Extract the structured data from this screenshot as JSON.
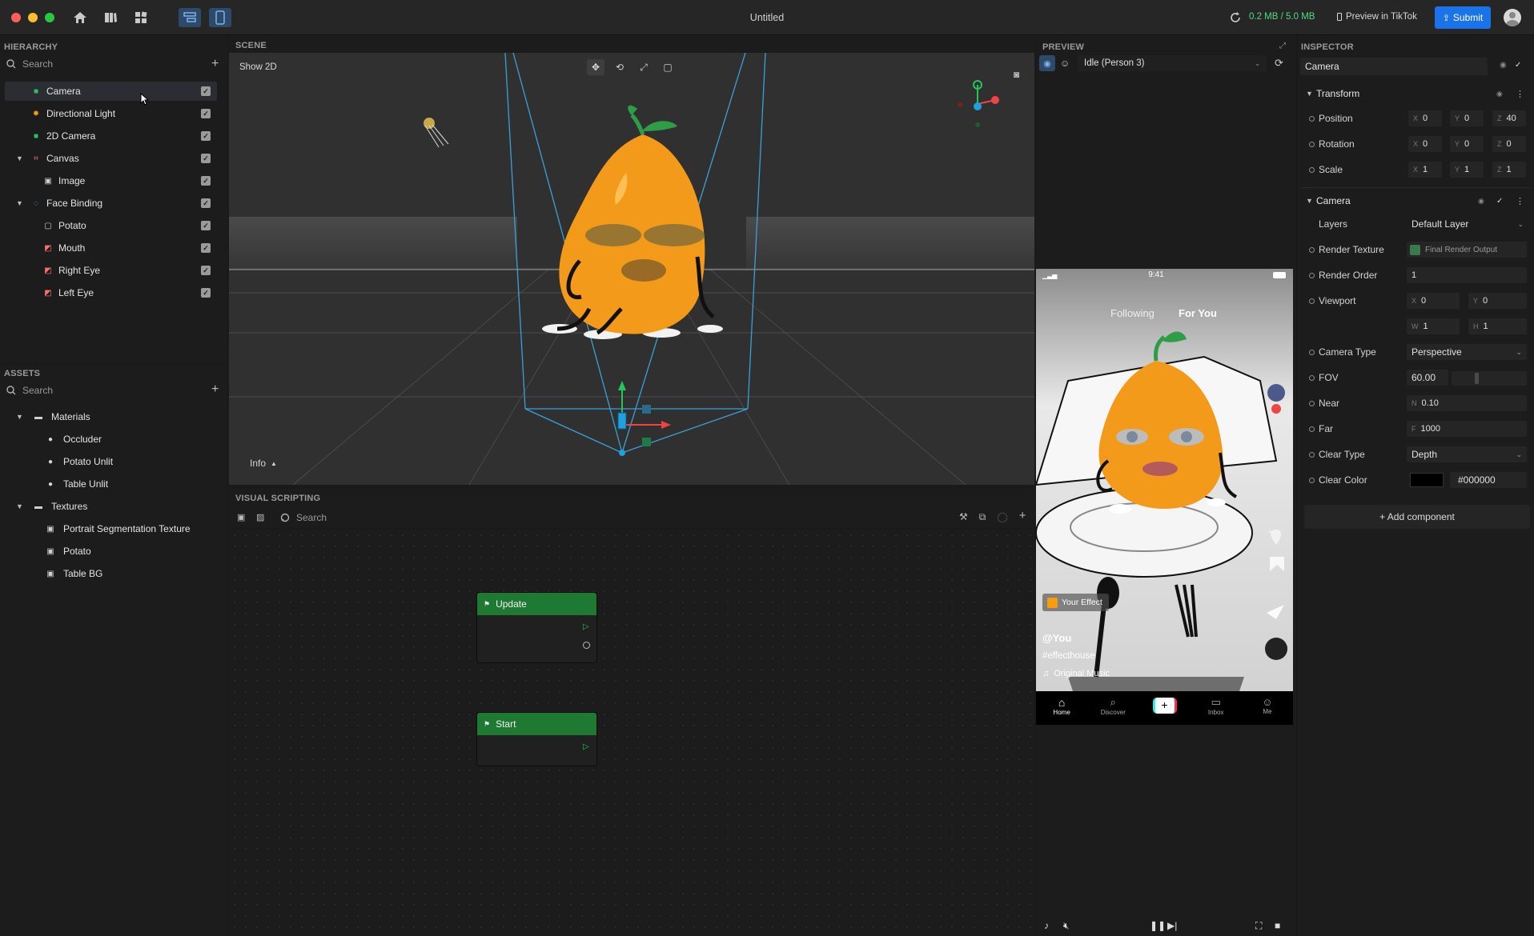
{
  "window": {
    "title": "Untitled",
    "memory": "0.2 MB / 5.0 MB",
    "preview_tiktok": "Preview in TikTok",
    "submit": "Submit"
  },
  "hierarchy": {
    "title": "HIERARCHY",
    "search_placeholder": "Search",
    "items": [
      {
        "label": "Camera",
        "icon": "camera-icon",
        "color": "#22c55e"
      },
      {
        "label": "Directional Light",
        "icon": "sun-icon",
        "color": "#f59e0b"
      },
      {
        "label": "2D Camera",
        "icon": "camera-icon",
        "color": "#22c55e"
      },
      {
        "label": "Canvas",
        "icon": "canvas-icon",
        "color": "#f87171"
      },
      {
        "label": "Image",
        "icon": "image-icon",
        "color": "#cfcfcf"
      },
      {
        "label": "Face Binding",
        "icon": "face-binding-icon",
        "color": "#60a5fa"
      },
      {
        "label": "Potato",
        "icon": "object-icon",
        "color": "#cfcfcf"
      },
      {
        "label": "Mouth",
        "icon": "face-sticker-icon",
        "color": "#f87171"
      },
      {
        "label": "Right Eye",
        "icon": "face-sticker-icon",
        "color": "#f87171"
      },
      {
        "label": "Left Eye",
        "icon": "face-sticker-icon",
        "color": "#f87171"
      }
    ]
  },
  "assets": {
    "title": "ASSETS",
    "search_placeholder": "Search",
    "items": [
      {
        "label": "Materials",
        "icon": "folder-icon"
      },
      {
        "label": "Occluder",
        "icon": "material-icon"
      },
      {
        "label": "Potato Unlit",
        "icon": "material-icon"
      },
      {
        "label": "Table Unlit",
        "icon": "material-icon"
      },
      {
        "label": "Textures",
        "icon": "folder-icon"
      },
      {
        "label": "Portrait Segmentation Texture",
        "icon": "texture-icon"
      },
      {
        "label": "Potato",
        "icon": "texture-icon"
      },
      {
        "label": "Table BG",
        "icon": "texture-icon"
      }
    ]
  },
  "scene": {
    "title": "SCENE",
    "show2d": "Show 2D",
    "info": "Info"
  },
  "visual_scripting": {
    "title": "VISUAL SCRIPTING",
    "search_placeholder": "Search",
    "nodes": [
      {
        "label": "Update"
      },
      {
        "label": "Start"
      }
    ]
  },
  "preview": {
    "title": "PREVIEW",
    "mode": "Idle (Person 3)",
    "phone": {
      "time": "9:41",
      "tab_following": "Following",
      "tab_foryou": "For You",
      "effect_label": "Your Effect",
      "username": "@You",
      "hashtag": "#effecthouse",
      "music": "Original Music",
      "nav": [
        "Home",
        "Discover",
        "+",
        "Inbox",
        "Me"
      ]
    }
  },
  "inspector": {
    "title": "INSPECTOR",
    "object_name": "Camera",
    "transform": {
      "title": "Transform",
      "position_label": "Position",
      "rotation_label": "Rotation",
      "scale_label": "Scale",
      "position": {
        "x": "0",
        "y": "0",
        "z": "40"
      },
      "rotation": {
        "x": "0",
        "y": "0",
        "z": "0"
      },
      "scale": {
        "x": "1",
        "y": "1",
        "z": "1"
      }
    },
    "camera": {
      "title": "Camera",
      "layers_label": "Layers",
      "layers": "Default Layer",
      "render_texture_label": "Render Texture",
      "render_texture": "Final Render Output",
      "render_order_label": "Render Order",
      "render_order": "1",
      "viewport_label": "Viewport",
      "viewport": {
        "x": "0",
        "y": "0",
        "w": "1",
        "h": "1"
      },
      "camera_type_label": "Camera Type",
      "camera_type": "Perspective",
      "fov_label": "FOV",
      "fov": "60.00",
      "near_label": "Near",
      "near": "0.10",
      "far_label": "Far",
      "far": "1000",
      "clear_type_label": "Clear Type",
      "clear_type": "Depth",
      "clear_color_label": "Clear Color",
      "clear_color": "#000000"
    },
    "add_component": "+ Add component"
  },
  "colors": {
    "accent": "#1a73e8",
    "node_header": "#1e7a32",
    "memory_text": "#4ade80"
  }
}
